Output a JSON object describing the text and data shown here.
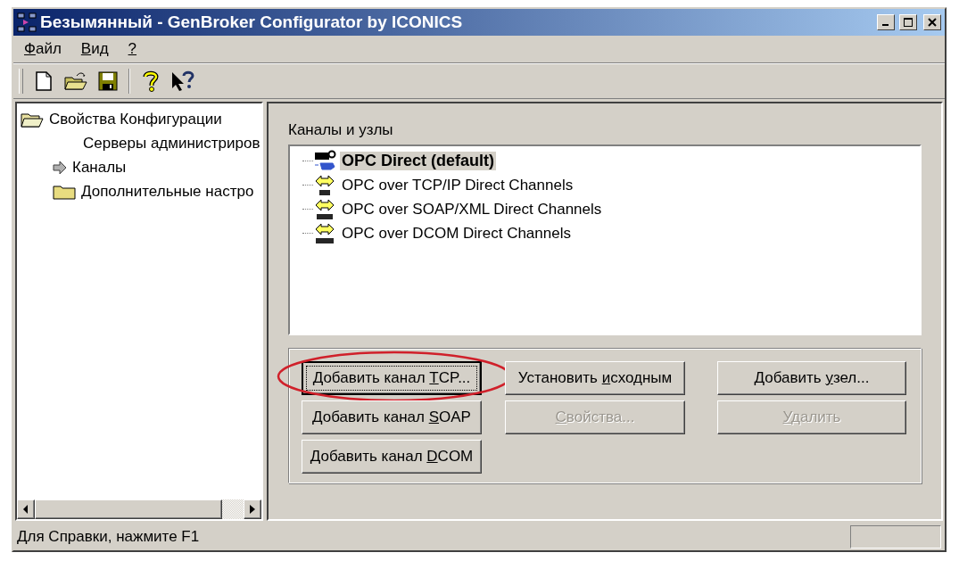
{
  "window": {
    "title": "Безымянный - GenBroker Configurator by ICONICS"
  },
  "menu": [
    {
      "key": "Ф",
      "post": "айл"
    },
    {
      "key": "В",
      "post": "ид"
    },
    {
      "key": "?"
    }
  ],
  "toolbar": [
    {
      "kind": "new"
    },
    {
      "kind": "open"
    },
    {
      "kind": "save"
    },
    {
      "kind": "separator"
    },
    {
      "kind": "help"
    },
    {
      "kind": "context-help"
    }
  ],
  "tree": [
    {
      "label": "Свойства Конфигурации",
      "kind": "root",
      "children": [
        {
          "label": "Серверы администриров",
          "kind": "plain",
          "selected": false
        },
        {
          "label": "Каналы",
          "kind": "current",
          "selected": false
        },
        {
          "label": "Дополнительные настро",
          "kind": "folder",
          "selected": false
        }
      ]
    }
  ],
  "channels": {
    "label": "Каналы и узлы",
    "items": [
      {
        "label": "OPC Direct (default)",
        "kind": "opc",
        "selected": true,
        "default": true
      },
      {
        "label": "OPC over TCP/IP Direct Channels",
        "kind": "tcp",
        "selected": false,
        "default": false
      },
      {
        "label": "OPC over SOAP/XML Direct Channels",
        "kind": "soap",
        "selected": false,
        "default": false
      },
      {
        "label": "OPC over DCOM Direct Channels",
        "kind": "dcom",
        "selected": false,
        "default": false
      }
    ]
  },
  "buttons": [
    [
      {
        "pre": "Добавить канал ",
        "key": "T",
        "post": "CP...",
        "disabled": false,
        "focused": true,
        "circled": true
      },
      {
        "pre": "Добавить канал  ",
        "key": "S",
        "post": "OAP",
        "disabled": false,
        "focused": false,
        "circled": false
      },
      {
        "pre": "Добавить канал ",
        "key": "D",
        "post": "COM",
        "disabled": false,
        "focused": false,
        "circled": false
      }
    ],
    [
      {
        "pre": "Установить ",
        "key": "и",
        "post": "сходным",
        "disabled": false,
        "focused": false,
        "circled": false
      },
      {
        "key": "С",
        "post": "войства...",
        "disabled": true,
        "focused": false,
        "circled": false
      }
    ],
    [
      {
        "pre": "Добавить ",
        "key": "у",
        "post": "зел...",
        "disabled": false,
        "focused": false,
        "circled": false
      },
      {
        "key": "У",
        "post": "далить",
        "disabled": true,
        "focused": false,
        "circled": false
      }
    ]
  ],
  "status_bar": {
    "text": "Для Справки, нажмите F1"
  }
}
